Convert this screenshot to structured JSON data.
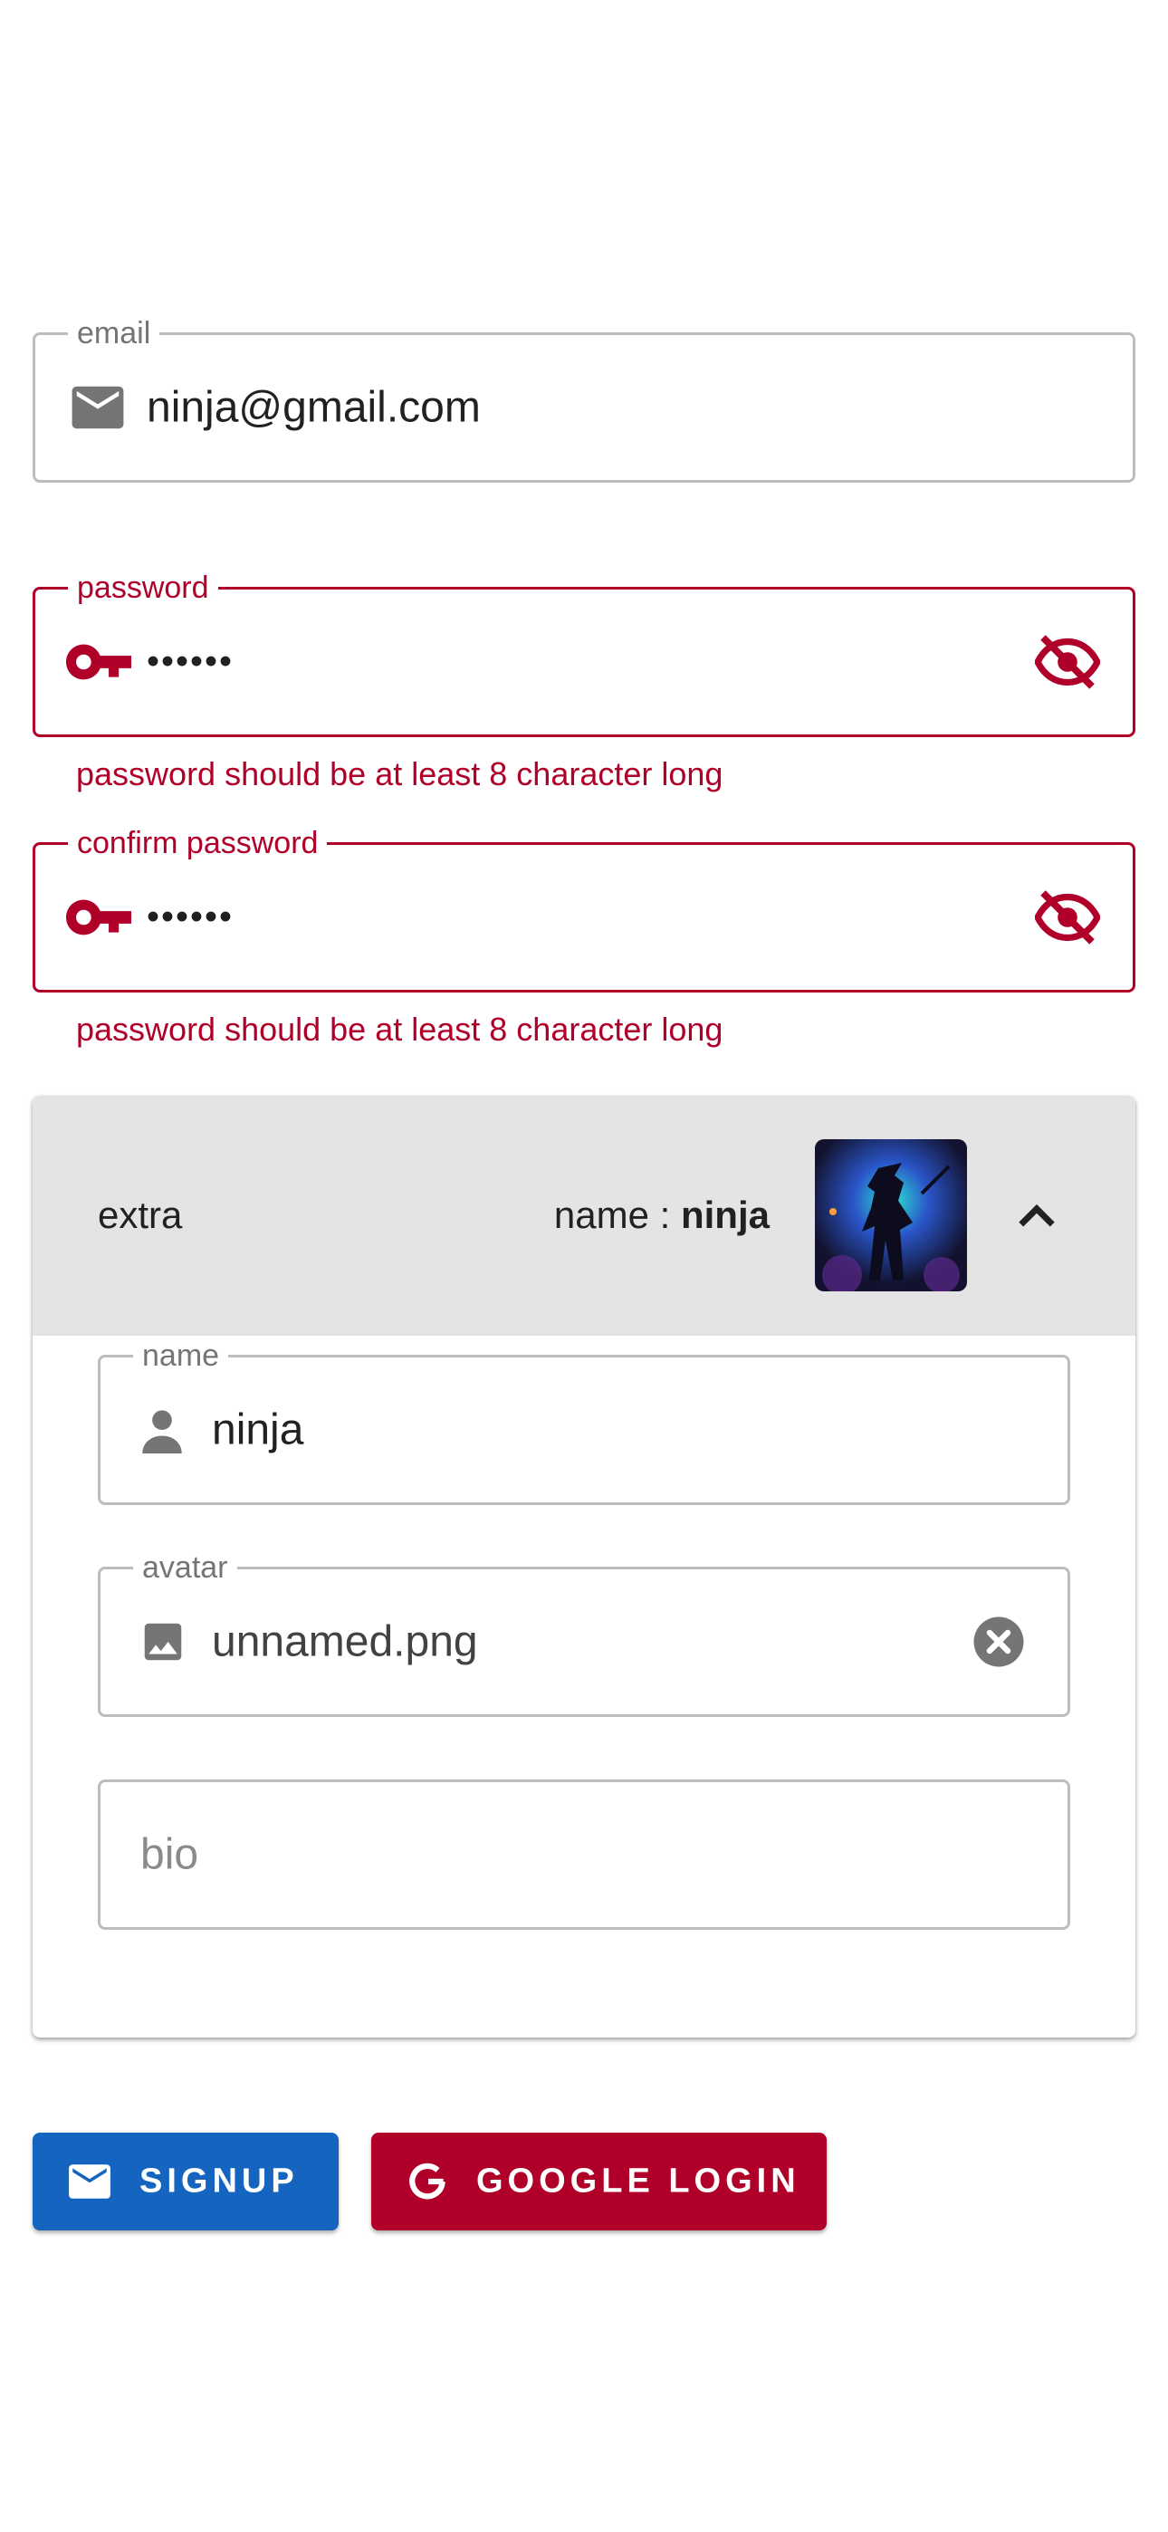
{
  "email": {
    "label": "email",
    "value": "ninja@gmail.com"
  },
  "password": {
    "label": "password",
    "value": "••••••",
    "error": "password should be at least 8 character long"
  },
  "confirm_password": {
    "label": "confirm password",
    "value": "••••••",
    "error": "password should be at least 8 character long"
  },
  "extra": {
    "title": "extra",
    "summary_prefix": "name : ",
    "summary_name": "ninja",
    "name_field": {
      "label": "name",
      "value": "ninja"
    },
    "avatar_field": {
      "label": "avatar",
      "value": "unnamed.png"
    },
    "bio_field": {
      "placeholder": "bio"
    }
  },
  "actions": {
    "signup_label": "SIGNUP",
    "google_label": "GOOGLE LOGIN"
  },
  "colors": {
    "error": "#b0002a",
    "signup": "#1565c0",
    "google": "#b0002a",
    "accordion_header": "#e4e4e4"
  },
  "icons": [
    "mail-icon",
    "key-icon",
    "eye-off-icon",
    "person-icon",
    "image-icon",
    "clear-icon",
    "chevron-up-icon",
    "google-icon"
  ]
}
